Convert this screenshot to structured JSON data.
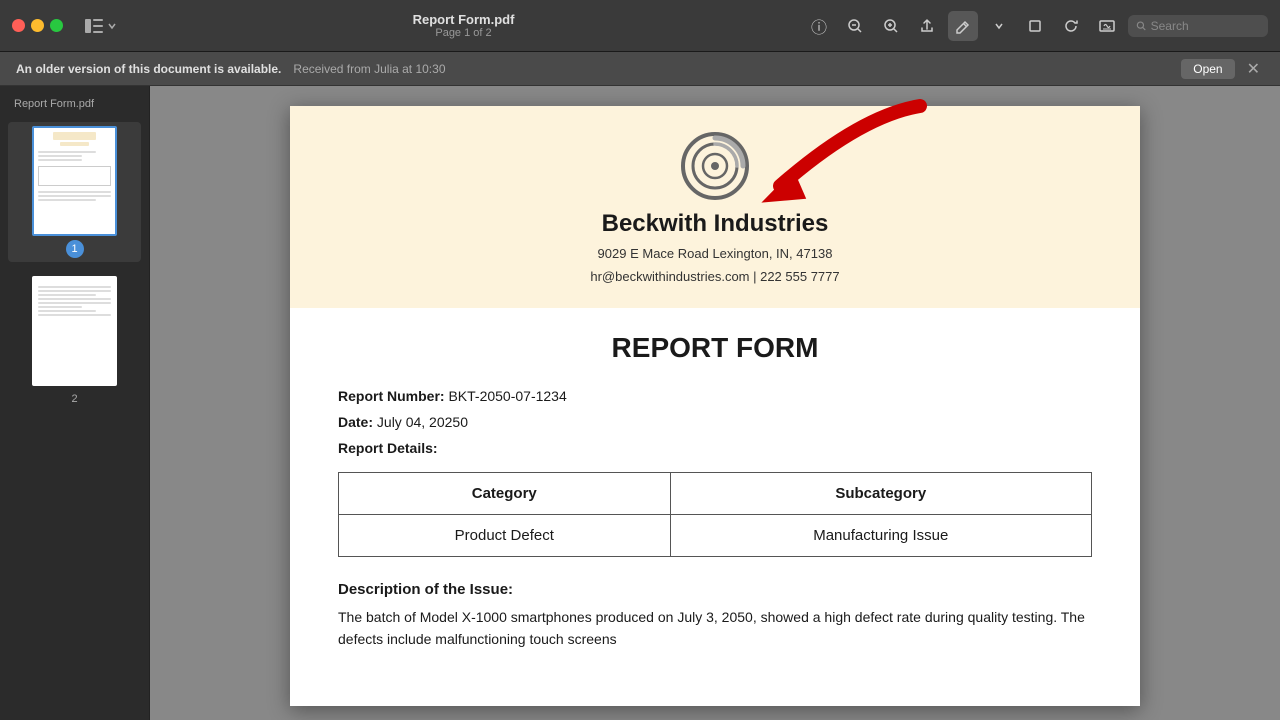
{
  "titlebar": {
    "filename": "Report Form.pdf",
    "pages": "Page 1 of 2"
  },
  "notification": {
    "message_bold": "An older version of this document is available.",
    "message_detail": "Received from Julia at 10:30",
    "open_label": "Open",
    "close_label": "✕"
  },
  "sidebar": {
    "label": "Report Form.pdf",
    "pages": [
      {
        "num": "1",
        "active": true
      },
      {
        "num": "2",
        "active": false
      }
    ]
  },
  "pdf": {
    "company": {
      "name": "Beckwith Industries",
      "address": "9029 E Mace Road Lexington, IN, 47138",
      "contact": "hr@beckwithindustries.com | 222 555 7777"
    },
    "form_title": "REPORT FORM",
    "report_number_label": "Report Number:",
    "report_number_value": "BKT-2050-07-1234",
    "date_label": "Date:",
    "date_value": "July 04, 20250",
    "details_label": "Report Details:",
    "table": {
      "headers": [
        "Category",
        "Subcategory"
      ],
      "rows": [
        [
          "Product Defect",
          "Manufacturing Issue"
        ]
      ]
    },
    "description_title": "Description of the Issue:",
    "description_text": "The batch of Model X-1000 smartphones produced on July 3, 2050, showed a high defect rate during quality testing. The defects include malfunctioning touch screens"
  },
  "toolbar": {
    "icons": [
      "ℹ",
      "🔍-",
      "🔍+",
      "⬆",
      "✏",
      "▾",
      "⬜",
      "⟳",
      "✉"
    ],
    "search_placeholder": "Search"
  }
}
